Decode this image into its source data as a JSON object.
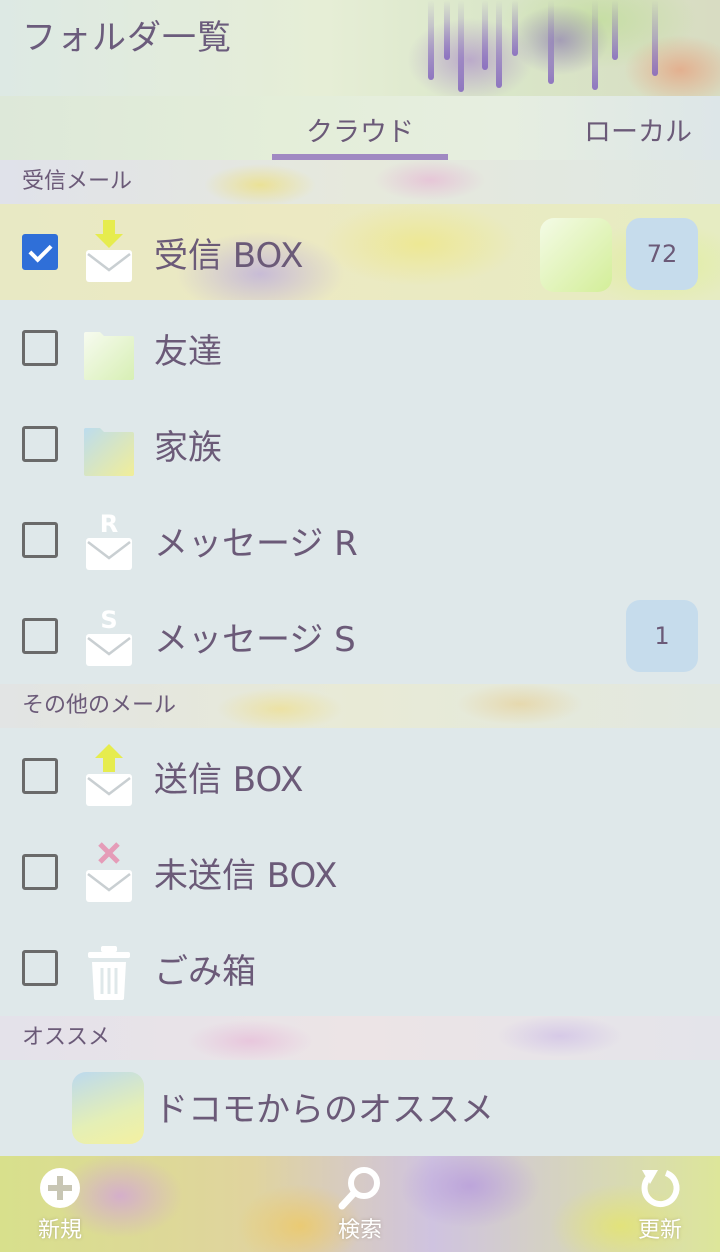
{
  "header": {
    "title": "フォルダ一覧"
  },
  "tabs": [
    {
      "label": "クラウド",
      "active": true
    },
    {
      "label": "ローカル",
      "active": false
    }
  ],
  "sections": [
    {
      "title": "受信メール",
      "items": [
        {
          "label": "受信 BOX",
          "icon": "inbox-icon",
          "checked": true,
          "count": "72"
        },
        {
          "label": "友達",
          "icon": "folder-icon",
          "checked": false,
          "count": ""
        },
        {
          "label": "家族",
          "icon": "folder-icon",
          "checked": false,
          "count": ""
        },
        {
          "label": "メッセージ R",
          "icon": "message-r-icon",
          "checked": false,
          "count": ""
        },
        {
          "label": "メッセージ S",
          "icon": "message-s-icon",
          "checked": false,
          "count": "1"
        }
      ]
    },
    {
      "title": "その他のメール",
      "items": [
        {
          "label": "送信 BOX",
          "icon": "outbox-icon",
          "checked": false
        },
        {
          "label": "未送信 BOX",
          "icon": "unsent-icon",
          "checked": false
        },
        {
          "label": "ごみ箱",
          "icon": "trash-icon",
          "checked": false
        }
      ]
    },
    {
      "title": "オススメ",
      "items": [
        {
          "label": "ドコモからのオススメ",
          "icon": "recommend-thumbnail"
        }
      ]
    }
  ],
  "bottom_nav": {
    "new_label": "新規",
    "search_label": "検索",
    "refresh_label": "更新"
  },
  "colors": {
    "accent": "#a089c2",
    "checkbox_checked": "#2f6fd8",
    "text": "#6b5a78",
    "badge": "#c6dcec",
    "row_bg": "#dfe8ea"
  }
}
